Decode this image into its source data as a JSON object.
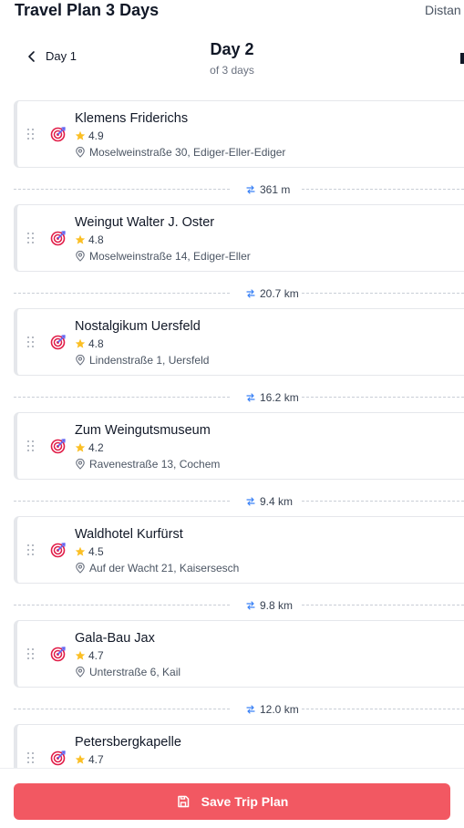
{
  "header": {
    "title": "Travel Plan 3 Days",
    "distance_toggle": "Distan"
  },
  "day_nav": {
    "prev_label": "Day 1",
    "day_title": "Day 2",
    "day_sub": "of 3 days"
  },
  "colors": {
    "accent": "#f25862",
    "star": "#fbbf24",
    "route_icon": "#3b82f6",
    "poi_icon": "#e11d48"
  },
  "stops": [
    {
      "name": "Klemens Friderichs",
      "rating": "4.9",
      "address": "Moselweinstraße 30, Ediger-Eller-Ediger"
    },
    {
      "name": "Weingut Walter J. Oster",
      "rating": "4.8",
      "address": "Moselweinstraße 14, Ediger-Eller"
    },
    {
      "name": "Nostalgikum Uersfeld",
      "rating": "4.8",
      "address": "Lindenstraße 1, Uersfeld"
    },
    {
      "name": "Zum Weingutsmuseum",
      "rating": "4.2",
      "address": "Ravenestraße 13, Cochem"
    },
    {
      "name": "Waldhotel Kurfürst",
      "rating": "4.5",
      "address": "Auf der Wacht 21, Kaisersesch"
    },
    {
      "name": "Gala-Bau Jax",
      "rating": "4.7",
      "address": "Unterstraße 6, Kail"
    },
    {
      "name": "Petersbergkapelle",
      "rating": "4.7",
      "address": ""
    }
  ],
  "distances": [
    "361 m",
    "20.7 km",
    "16.2 km",
    "9.4 km",
    "9.8 km",
    "12.0 km"
  ],
  "footer": {
    "save_label": "Save Trip Plan"
  }
}
